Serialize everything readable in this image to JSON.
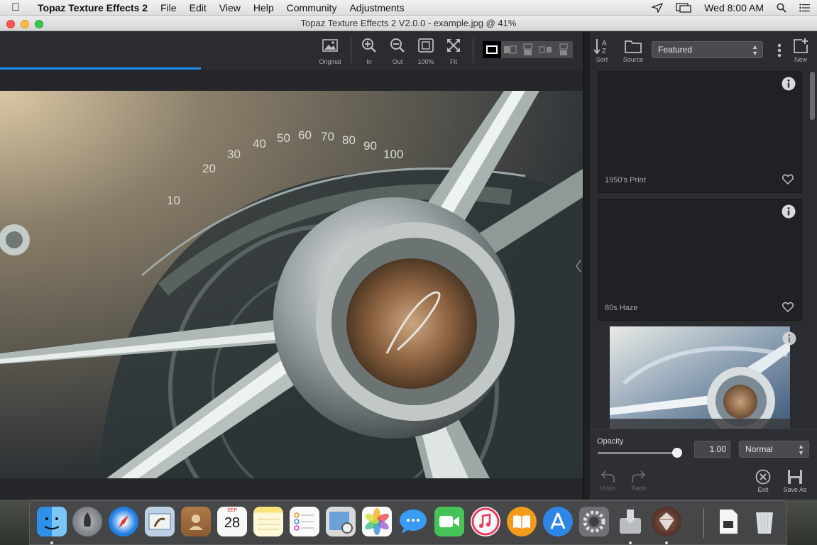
{
  "menubar": {
    "app_name": "Topaz Texture Effects 2",
    "items": [
      "File",
      "Edit",
      "View",
      "Help",
      "Community",
      "Adjustments"
    ],
    "clock": "Wed 8:00 AM"
  },
  "window": {
    "title": "Topaz Texture Effects 2 V2.0.0 - example.jpg @ 41%"
  },
  "toolbar": {
    "original": "Original",
    "zoom_in": "In",
    "zoom_out": "Out",
    "zoom_100": "100%",
    "fit": "Fit"
  },
  "right_panel": {
    "sort_label": "Sort",
    "source_label": "Source",
    "category_select": "Featured",
    "new_label": "New",
    "presets": [
      {
        "name": "1950's Print"
      },
      {
        "name": "80s Haze"
      },
      {
        "name": ""
      }
    ]
  },
  "bottom": {
    "opacity_label": "Opacity",
    "opacity_value": "1.00",
    "opacity_level": 1.0,
    "blend_mode": "Normal",
    "undo_label": "Undo",
    "redo_label": "Redo",
    "exit_label": "Exit",
    "save_as_label": "Save As"
  },
  "colors": {
    "accent": "#1d8ff0",
    "panel": "#2b2c2f"
  },
  "dock": {
    "apps": [
      "finder-icon",
      "launchpad-icon",
      "safari-icon",
      "mail-icon",
      "contacts-icon",
      "calendar-icon",
      "notes-icon",
      "reminders-icon",
      "preview-icon",
      "photos-icon",
      "messages-icon",
      "facetime-icon",
      "itunes-icon",
      "ibooks-icon",
      "app-store-icon",
      "system-preferences-icon",
      "installer-icon",
      "topaz-icon",
      "document-icon",
      "trash-icon"
    ],
    "calendar_month": "SEP",
    "calendar_day": "28"
  }
}
